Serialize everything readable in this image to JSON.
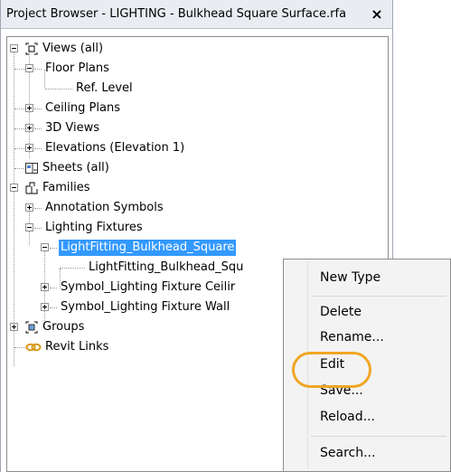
{
  "window": {
    "title": "Project Browser - LIGHTING - Bulkhead Square Surface.rfa",
    "close_glyph": "×"
  },
  "tree": {
    "views_all": "Views (all)",
    "floor_plans": "Floor Plans",
    "ref_level": "Ref. Level",
    "ceiling_plans": "Ceiling Plans",
    "views_3d": "3D Views",
    "elevations": "Elevations (Elevation 1)",
    "sheets_all": "Sheets (all)",
    "families": "Families",
    "annotation_symbols": "Annotation Symbols",
    "lighting_fixtures": "Lighting Fixtures",
    "lightfitting_family": "LightFitting_Bulkhead_Square",
    "lightfitting_type": "LightFitting_Bulkhead_Squ",
    "symbol_ceiling": "Symbol_Lighting Fixture Ceilir",
    "symbol_wall": "Symbol_Lighting Fixture Wall",
    "groups": "Groups",
    "revit_links": "Revit Links"
  },
  "context_menu": {
    "new_type": "New Type",
    "delete": "Delete",
    "rename": "Rename...",
    "edit": "Edit",
    "save": "Save...",
    "reload": "Reload...",
    "search": "Search..."
  },
  "colors": {
    "selection": "#3399ff",
    "highlight_ring": "#f0a623"
  }
}
